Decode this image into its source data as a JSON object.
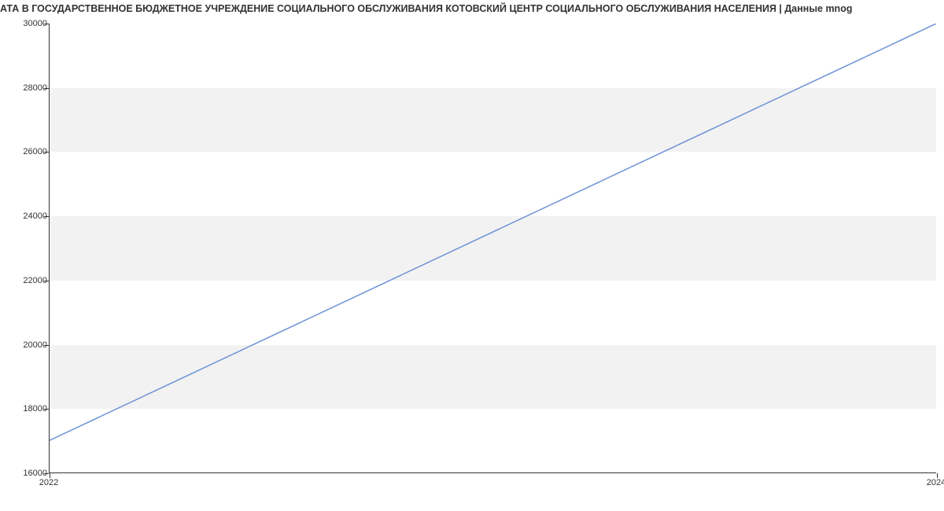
{
  "chart_data": {
    "type": "line",
    "title": "АТА В ГОСУДАРСТВЕННОЕ БЮДЖЕТНОЕ УЧРЕЖДЕНИЕ СОЦИАЛЬНОГО ОБСЛУЖИВАНИЯ КОТОВСКИЙ ЦЕНТР СОЦИАЛЬНОГО ОБСЛУЖИВАНИЯ НАСЕЛЕНИЯ | Данные mnog",
    "x": [
      2022,
      2024
    ],
    "values": [
      17000,
      30000
    ],
    "xlabel": "",
    "ylabel": "",
    "xlim": [
      2022,
      2024
    ],
    "ylim": [
      16000,
      30000
    ],
    "y_ticks": [
      16000,
      18000,
      20000,
      22000,
      24000,
      26000,
      28000,
      30000
    ],
    "x_ticks": [
      2022,
      2024
    ],
    "line_color": "#6f94d8",
    "grid_band_color": "#f2f2f2"
  }
}
